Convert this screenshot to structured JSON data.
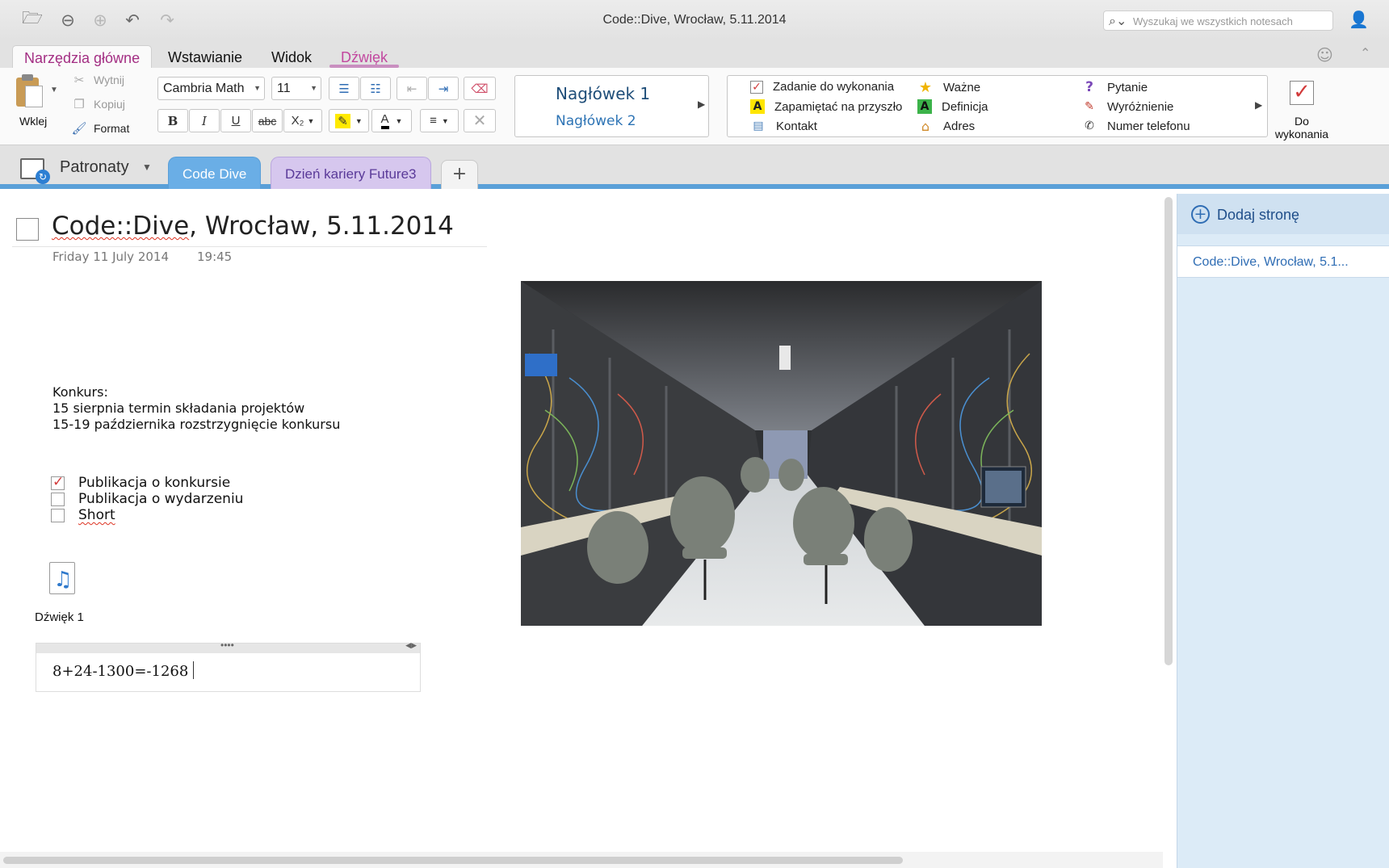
{
  "window": {
    "title": "Code::Dive, Wrocław, 5.11.2014",
    "search_placeholder": "Wyszukaj we wszystkich notesach"
  },
  "ribbon_tabs": [
    {
      "label": "Narzędzia główne",
      "active": true
    },
    {
      "label": "Wstawianie",
      "active": false
    },
    {
      "label": "Widok",
      "active": false
    },
    {
      "label": "Dźwięk",
      "active": false
    }
  ],
  "clipboard": {
    "paste": "Wklej",
    "cut": "Wytnij",
    "copy": "Kopiuj",
    "format": "Format"
  },
  "font": {
    "family": "Cambria Math",
    "size": "11"
  },
  "format_buttons": {
    "bold": "B",
    "italic": "I",
    "underline": "U",
    "strike": "abc",
    "subscript": "X₂"
  },
  "styles": {
    "heading1": "Nagłówek 1",
    "heading2": "Nagłówek 2"
  },
  "tags": [
    {
      "label": "Zadanie do wykonania",
      "icon": "checkbox-icon"
    },
    {
      "label": "Zapamiętać na przyszło",
      "icon": "highlight-a-icon"
    },
    {
      "label": "Kontakt",
      "icon": "contact-card-icon"
    },
    {
      "label": "Ważne",
      "icon": "star-icon"
    },
    {
      "label": "Definicja",
      "icon": "definition-a-icon"
    },
    {
      "label": "Adres",
      "icon": "house-icon"
    },
    {
      "label": "Pytanie",
      "icon": "question-icon"
    },
    {
      "label": "Wyróżnienie",
      "icon": "marker-icon"
    },
    {
      "label": "Numer telefonu",
      "icon": "phone-icon"
    }
  ],
  "todo_button": {
    "line1": "Do",
    "line2": "wykonania"
  },
  "notebook": {
    "name": "Patronaty",
    "sections": [
      {
        "label": "Code Dive",
        "active": true
      },
      {
        "label": "Dzień kariery Future3",
        "active": false
      }
    ],
    "add_section": "+"
  },
  "page": {
    "title_parts": [
      "Code::Dive",
      ", Wrocław, 5.11.2014"
    ],
    "date": "Friday 11 July 2014",
    "time": "19:45",
    "notes": [
      "Konkurs:",
      "15 sierpnia termin składania projektów",
      "15-19 października rozstrzygnięcie konkursu"
    ],
    "checklist": [
      {
        "label": "Publikacja o konkursie",
        "checked": true
      },
      {
        "label": "Publikacja o wydarzeniu",
        "checked": false
      },
      {
        "label": "Short",
        "checked": false
      }
    ],
    "audio_label": "Dźwięk 1",
    "equation": "8+24-1300=-1268"
  },
  "pages_pane": {
    "add_page": "Dodaj stronę",
    "pages": [
      "Code::Dive, Wrocław, 5.1..."
    ]
  },
  "colors": {
    "accent_tab": "#a32e83",
    "section_active": "#6aaee6",
    "section_purple": "#d6c7ee",
    "pane_blue": "#dcebf7",
    "link_blue": "#2f6db4"
  }
}
